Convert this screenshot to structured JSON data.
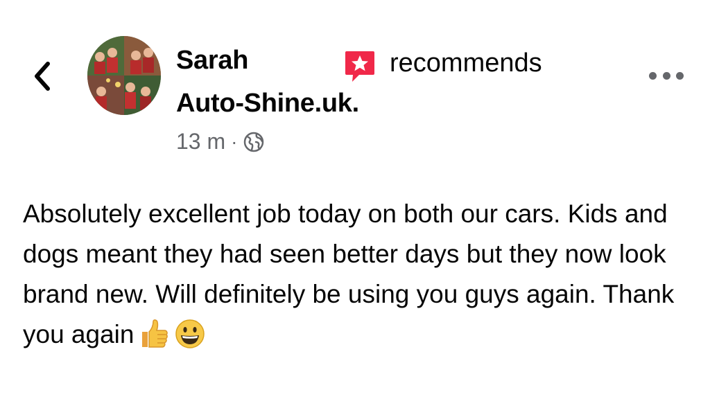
{
  "post": {
    "author_name": "Sarah",
    "action_text": "recommends",
    "page_name": "Auto-Shine.uk.",
    "timestamp": "13 m",
    "separator": "·",
    "body_text": "Absolutely excellent job today on both our cars. Kids and dogs meant they had seen better days but they now look brand new. Will definitely be using you guys again. Thank you again"
  },
  "icons": {
    "back": "chevron-left-icon",
    "recommend": "recommend-star-icon",
    "privacy": "globe-icon",
    "more": "more-options-icon",
    "emoji_1": "thumbs-up-emoji",
    "emoji_2": "grinning-face-emoji"
  },
  "colors": {
    "text_primary": "#050505",
    "text_secondary": "#65676b",
    "recommend_accent": "#f02849"
  }
}
